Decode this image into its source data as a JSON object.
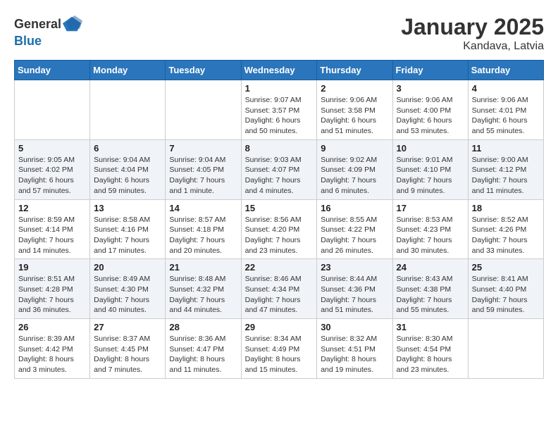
{
  "header": {
    "logo_general": "General",
    "logo_blue": "Blue",
    "month": "January 2025",
    "location": "Kandava, Latvia"
  },
  "weekdays": [
    "Sunday",
    "Monday",
    "Tuesday",
    "Wednesday",
    "Thursday",
    "Friday",
    "Saturday"
  ],
  "weeks": [
    [
      {
        "day": "",
        "content": ""
      },
      {
        "day": "",
        "content": ""
      },
      {
        "day": "",
        "content": ""
      },
      {
        "day": "1",
        "content": "Sunrise: 9:07 AM\nSunset: 3:57 PM\nDaylight: 6 hours and 50 minutes."
      },
      {
        "day": "2",
        "content": "Sunrise: 9:06 AM\nSunset: 3:58 PM\nDaylight: 6 hours and 51 minutes."
      },
      {
        "day": "3",
        "content": "Sunrise: 9:06 AM\nSunset: 4:00 PM\nDaylight: 6 hours and 53 minutes."
      },
      {
        "day": "4",
        "content": "Sunrise: 9:06 AM\nSunset: 4:01 PM\nDaylight: 6 hours and 55 minutes."
      }
    ],
    [
      {
        "day": "5",
        "content": "Sunrise: 9:05 AM\nSunset: 4:02 PM\nDaylight: 6 hours and 57 minutes."
      },
      {
        "day": "6",
        "content": "Sunrise: 9:04 AM\nSunset: 4:04 PM\nDaylight: 6 hours and 59 minutes."
      },
      {
        "day": "7",
        "content": "Sunrise: 9:04 AM\nSunset: 4:05 PM\nDaylight: 7 hours and 1 minute."
      },
      {
        "day": "8",
        "content": "Sunrise: 9:03 AM\nSunset: 4:07 PM\nDaylight: 7 hours and 4 minutes."
      },
      {
        "day": "9",
        "content": "Sunrise: 9:02 AM\nSunset: 4:09 PM\nDaylight: 7 hours and 6 minutes."
      },
      {
        "day": "10",
        "content": "Sunrise: 9:01 AM\nSunset: 4:10 PM\nDaylight: 7 hours and 9 minutes."
      },
      {
        "day": "11",
        "content": "Sunrise: 9:00 AM\nSunset: 4:12 PM\nDaylight: 7 hours and 11 minutes."
      }
    ],
    [
      {
        "day": "12",
        "content": "Sunrise: 8:59 AM\nSunset: 4:14 PM\nDaylight: 7 hours and 14 minutes."
      },
      {
        "day": "13",
        "content": "Sunrise: 8:58 AM\nSunset: 4:16 PM\nDaylight: 7 hours and 17 minutes."
      },
      {
        "day": "14",
        "content": "Sunrise: 8:57 AM\nSunset: 4:18 PM\nDaylight: 7 hours and 20 minutes."
      },
      {
        "day": "15",
        "content": "Sunrise: 8:56 AM\nSunset: 4:20 PM\nDaylight: 7 hours and 23 minutes."
      },
      {
        "day": "16",
        "content": "Sunrise: 8:55 AM\nSunset: 4:22 PM\nDaylight: 7 hours and 26 minutes."
      },
      {
        "day": "17",
        "content": "Sunrise: 8:53 AM\nSunset: 4:23 PM\nDaylight: 7 hours and 30 minutes."
      },
      {
        "day": "18",
        "content": "Sunrise: 8:52 AM\nSunset: 4:26 PM\nDaylight: 7 hours and 33 minutes."
      }
    ],
    [
      {
        "day": "19",
        "content": "Sunrise: 8:51 AM\nSunset: 4:28 PM\nDaylight: 7 hours and 36 minutes."
      },
      {
        "day": "20",
        "content": "Sunrise: 8:49 AM\nSunset: 4:30 PM\nDaylight: 7 hours and 40 minutes."
      },
      {
        "day": "21",
        "content": "Sunrise: 8:48 AM\nSunset: 4:32 PM\nDaylight: 7 hours and 44 minutes."
      },
      {
        "day": "22",
        "content": "Sunrise: 8:46 AM\nSunset: 4:34 PM\nDaylight: 7 hours and 47 minutes."
      },
      {
        "day": "23",
        "content": "Sunrise: 8:44 AM\nSunset: 4:36 PM\nDaylight: 7 hours and 51 minutes."
      },
      {
        "day": "24",
        "content": "Sunrise: 8:43 AM\nSunset: 4:38 PM\nDaylight: 7 hours and 55 minutes."
      },
      {
        "day": "25",
        "content": "Sunrise: 8:41 AM\nSunset: 4:40 PM\nDaylight: 7 hours and 59 minutes."
      }
    ],
    [
      {
        "day": "26",
        "content": "Sunrise: 8:39 AM\nSunset: 4:42 PM\nDaylight: 8 hours and 3 minutes."
      },
      {
        "day": "27",
        "content": "Sunrise: 8:37 AM\nSunset: 4:45 PM\nDaylight: 8 hours and 7 minutes."
      },
      {
        "day": "28",
        "content": "Sunrise: 8:36 AM\nSunset: 4:47 PM\nDaylight: 8 hours and 11 minutes."
      },
      {
        "day": "29",
        "content": "Sunrise: 8:34 AM\nSunset: 4:49 PM\nDaylight: 8 hours and 15 minutes."
      },
      {
        "day": "30",
        "content": "Sunrise: 8:32 AM\nSunset: 4:51 PM\nDaylight: 8 hours and 19 minutes."
      },
      {
        "day": "31",
        "content": "Sunrise: 8:30 AM\nSunset: 4:54 PM\nDaylight: 8 hours and 23 minutes."
      },
      {
        "day": "",
        "content": ""
      }
    ]
  ]
}
